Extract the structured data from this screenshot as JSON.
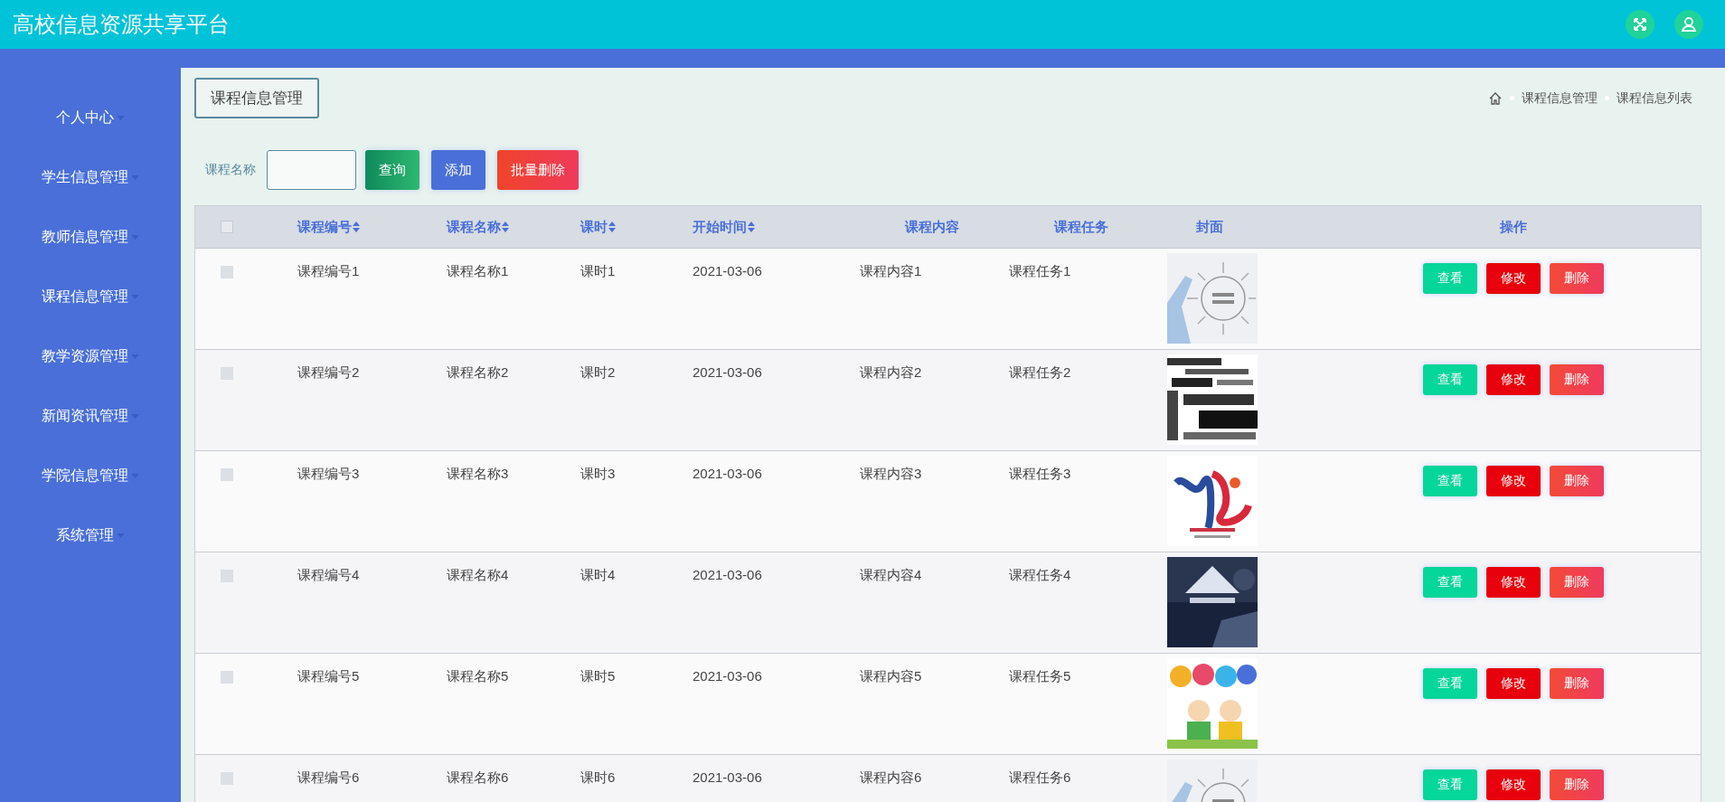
{
  "header": {
    "title": "高校信息资源共享平台"
  },
  "sidebar": {
    "items": [
      {
        "label": "个人中心"
      },
      {
        "label": "学生信息管理"
      },
      {
        "label": "教师信息管理"
      },
      {
        "label": "课程信息管理"
      },
      {
        "label": "教学资源管理"
      },
      {
        "label": "新闻资讯管理"
      },
      {
        "label": "学院信息管理"
      },
      {
        "label": "系统管理"
      }
    ]
  },
  "page_title": "课程信息管理",
  "breadcrumb": [
    "课程信息管理",
    "课程信息列表"
  ],
  "search": {
    "label": "课程名称",
    "buttons": [
      {
        "label": "查询",
        "kind": "query"
      },
      {
        "label": "添加",
        "kind": "add"
      },
      {
        "label": "批量删除",
        "kind": "delete"
      }
    ]
  },
  "table": {
    "select_all_checked": false,
    "columns": [
      {
        "label": "课程编号",
        "sortable": true
      },
      {
        "label": "课程名称",
        "sortable": true
      },
      {
        "label": "课时",
        "sortable": true
      },
      {
        "label": "开始时间",
        "sortable": true
      },
      {
        "label": "课程内容",
        "sortable": false
      },
      {
        "label": "课程任务",
        "sortable": false
      },
      {
        "label": "封面",
        "sortable": false
      },
      {
        "label": "操作",
        "sortable": false
      }
    ],
    "rows": [
      {
        "checked": false,
        "cells": [
          "课程编号1",
          "课程名称1",
          "课时1",
          "2021-03-06",
          "课程内容1",
          "课程任务1"
        ],
        "actions": [
          {
            "label": "查看",
            "kind": "view"
          },
          {
            "label": "修改",
            "kind": "edit"
          },
          {
            "label": "删除",
            "kind": "delete"
          }
        ]
      },
      {
        "checked": false,
        "cells": [
          "课程编号2",
          "课程名称2",
          "课时2",
          "2021-03-06",
          "课程内容2",
          "课程任务2"
        ],
        "actions": [
          {
            "label": "查看",
            "kind": "view"
          },
          {
            "label": "修改",
            "kind": "edit"
          },
          {
            "label": "删除",
            "kind": "delete"
          }
        ]
      },
      {
        "checked": false,
        "cells": [
          "课程编号3",
          "课程名称3",
          "课时3",
          "2021-03-06",
          "课程内容3",
          "课程任务3"
        ],
        "actions": [
          {
            "label": "查看",
            "kind": "view"
          },
          {
            "label": "修改",
            "kind": "edit"
          },
          {
            "label": "删除",
            "kind": "delete"
          }
        ]
      },
      {
        "checked": false,
        "cells": [
          "课程编号4",
          "课程名称4",
          "课时4",
          "2021-03-06",
          "课程内容4",
          "课程任务4"
        ],
        "actions": [
          {
            "label": "查看",
            "kind": "view"
          },
          {
            "label": "修改",
            "kind": "edit"
          },
          {
            "label": "删除",
            "kind": "delete"
          }
        ]
      },
      {
        "checked": false,
        "cells": [
          "课程编号5",
          "课程名称5",
          "课时5",
          "2021-03-06",
          "课程内容5",
          "课程任务5"
        ],
        "actions": [
          {
            "label": "查看",
            "kind": "view"
          },
          {
            "label": "修改",
            "kind": "edit"
          },
          {
            "label": "删除",
            "kind": "delete"
          }
        ]
      },
      {
        "checked": false,
        "cells": [
          "课程编号6",
          "课程名称6",
          "课时6",
          "2021-03-06",
          "课程内容6",
          "课程任务6"
        ],
        "actions": [
          {
            "label": "查看",
            "kind": "view"
          },
          {
            "label": "修改",
            "kind": "edit"
          },
          {
            "label": "删除",
            "kind": "delete"
          }
        ]
      }
    ]
  }
}
